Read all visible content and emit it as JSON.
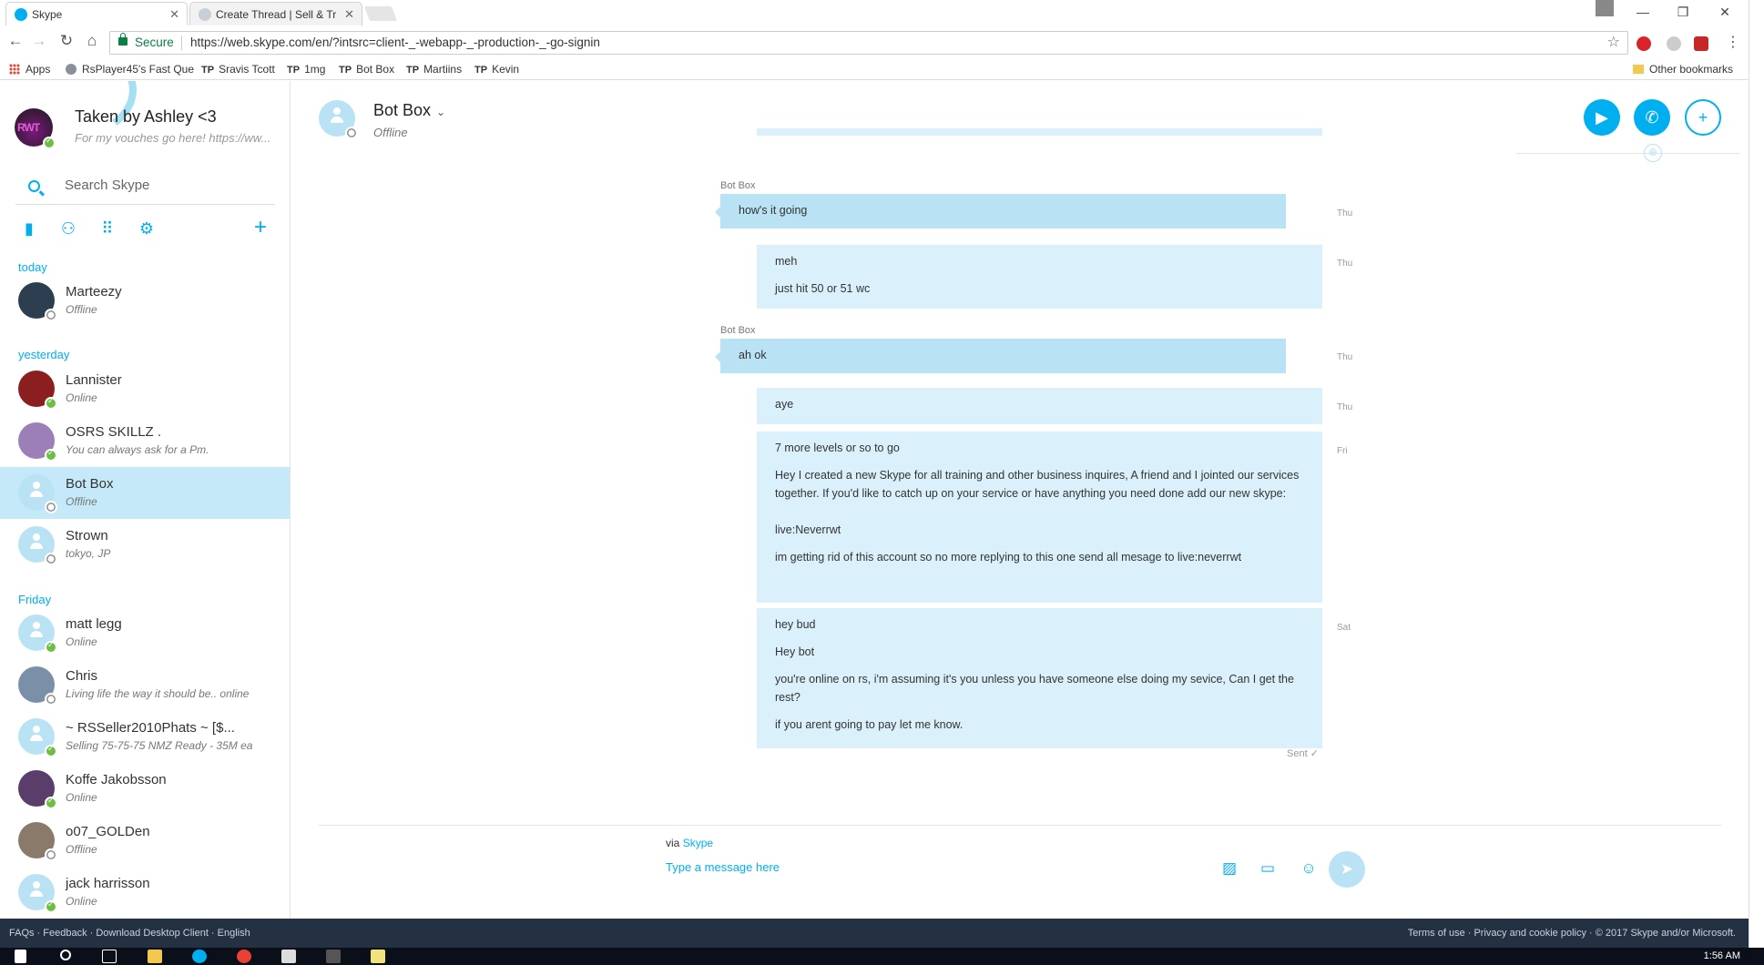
{
  "browser": {
    "tabs": [
      {
        "label": "Skype",
        "active": true
      },
      {
        "label": "Create Thread | Sell & Tr",
        "active": false
      }
    ],
    "secure_label": "Secure",
    "url": "https://web.skype.com/en/?intsrc=client-_-webapp-_-production-_-go-signin",
    "bookmarks": [
      "Apps",
      "RsPlayer45's Fast Que",
      "Sravis Tcott",
      "1mg",
      "Bot Box",
      "Martiins",
      "Kevin"
    ],
    "bookmark_tp": "TP",
    "other_bookmarks": "Other bookmarks"
  },
  "sidebar": {
    "profile": {
      "name": "Taken by Ashley <3",
      "mood": "For my vouches go here! https://ww...",
      "avatar_text": "RWT"
    },
    "search_placeholder": "Search Skype",
    "sections": {
      "today": "today",
      "yesterday": "yesterday",
      "friday": "Friday"
    },
    "contacts": [
      {
        "name": "Marteezy",
        "mood": "Offline",
        "status": "offline",
        "avatar": "#2c3e50"
      },
      {
        "name": "Lannister",
        "mood": "Online",
        "status": "online",
        "avatar": "#8b1e1e"
      },
      {
        "name": "OSRS SKILLZ .",
        "mood": "You can always ask for a Pm.",
        "status": "online",
        "avatar": "#9b7fb6"
      },
      {
        "name": "Bot Box",
        "mood": "Offline",
        "status": "offline",
        "avatar": "#b9e3f5"
      },
      {
        "name": "Strown",
        "mood": "tokyo, JP",
        "status": "offline",
        "avatar": "#b9e3f5"
      },
      {
        "name": "matt legg",
        "mood": "Online",
        "status": "online",
        "avatar": "#b9e3f5"
      },
      {
        "name": "Chris",
        "mood": "Living life the way it should be.. online",
        "status": "offline",
        "avatar": "#7a8fa8"
      },
      {
        "name": "~ RSSeller2010Phats ~ [$...",
        "mood": "Selling 75-75-75 NMZ Ready - 35M ea",
        "status": "online",
        "avatar": "#b9e3f5"
      },
      {
        "name": "Koffe Jakobsson",
        "mood": "Online",
        "status": "online",
        "avatar": "#5a3d6b"
      },
      {
        "name": "o07_GOLDen",
        "mood": "Offline",
        "status": "offline",
        "avatar": "#8a7a6a"
      },
      {
        "name": "jack harrisson",
        "mood": "Online",
        "status": "online",
        "avatar": "#b9e3f5"
      }
    ]
  },
  "conversation": {
    "title": "Bot Box",
    "status": "Offline",
    "messages": [
      {
        "sender": "Bot Box",
        "dir": "in",
        "lines": [
          "how's it going"
        ],
        "time": "Thu"
      },
      {
        "dir": "out",
        "lines": [
          "meh",
          "just hit 50 or 51 wc"
        ],
        "time": "Thu"
      },
      {
        "sender": "Bot Box",
        "dir": "in",
        "lines": [
          "ah ok"
        ],
        "time": "Thu"
      },
      {
        "dir": "out",
        "lines": [
          "aye"
        ],
        "time": "Thu"
      },
      {
        "dir": "out",
        "lines": [
          "7 more levels or so to go",
          "Hey I created a new Skype for all training and other business inquires, A friend and I jointed our services together. If you'd like to catch up on your service or have anything you need done add our new skype:",
          "live:Neverrwt",
          "im getting rid of this account so no more replying to this one send all mesage to live:neverrwt"
        ],
        "time": "Fri"
      },
      {
        "dir": "out",
        "lines": [
          "hey bud",
          "Hey bot",
          "you're online on rs, i'm assuming it's you unless you have someone else doing my sevice, Can I get the rest?",
          "if you arent going to pay let me know."
        ],
        "time": "Sat"
      }
    ],
    "sent_label": "Sent",
    "via_prefix": "via",
    "via_link": "Skype",
    "input_placeholder": "Type a message here"
  },
  "footer": {
    "left": "FAQs · Feedback · Download Desktop Client · English",
    "right": "Terms of use · Privacy and cookie policy · © 2017 Skype and/or Microsoft."
  },
  "taskbar": {
    "clock": "1:56 AM"
  },
  "colors": {
    "accent": "#00aff0",
    "bubble_in": "#b9e3f5",
    "bubble_out": "#daf1fb",
    "selected": "#c5e9f8",
    "online": "#6cbe45",
    "footer": "#233143"
  }
}
